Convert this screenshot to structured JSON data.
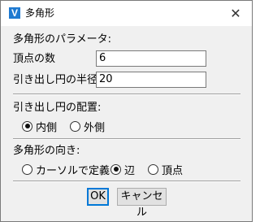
{
  "window": {
    "title": "多角形",
    "app_icon": "V",
    "close_glyph": "✕"
  },
  "params": {
    "heading": "多角形のパラメータ:",
    "vertices_label": "頂点の数",
    "vertices_value": "6",
    "radius_label": "引き出し円の半径",
    "radius_value": "20"
  },
  "placement": {
    "heading": "引き出し円の配置:",
    "options": [
      {
        "label": "内側",
        "checked": true
      },
      {
        "label": "外側",
        "checked": false
      }
    ]
  },
  "orientation": {
    "heading": "多角形の向き:",
    "options": [
      {
        "label": "カーソルで定義",
        "checked": false
      },
      {
        "label": "辺",
        "checked": true
      },
      {
        "label": "頂点",
        "checked": false
      }
    ]
  },
  "buttons": {
    "ok": "OK",
    "cancel": "キャンセル"
  },
  "colors": {
    "app_icon_blue": "#1f7ad1",
    "dialog_bg": "#f0f0f0",
    "default_button_border": "#0078d7"
  }
}
